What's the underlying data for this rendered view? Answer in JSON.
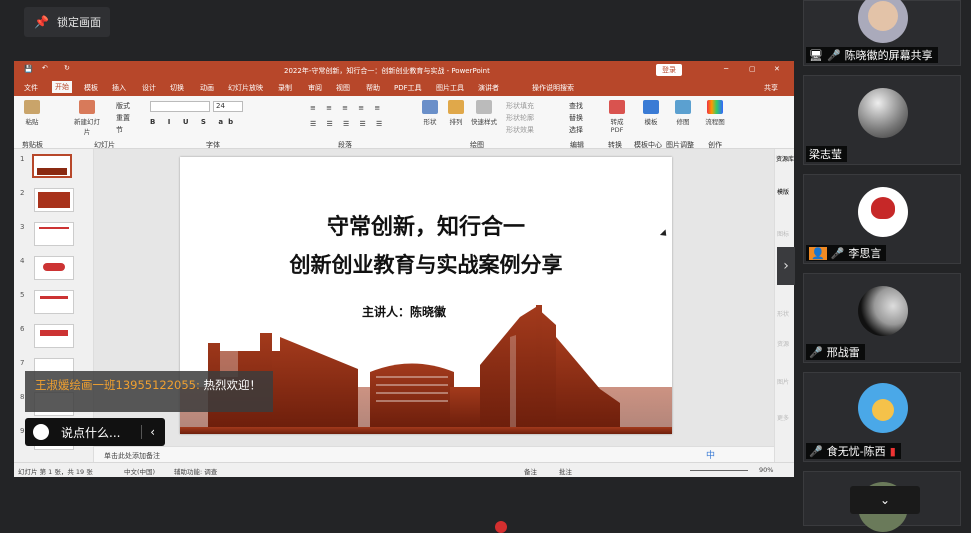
{
  "lock_button": {
    "label": "锁定画面",
    "icon": "pin-icon"
  },
  "ppt": {
    "window_title": "2022年-守常创新，知行合一：创新创业教育与实战 - PowerPoint",
    "login_button": "登录",
    "window_controls": {
      "minimize": "─",
      "restore": "▢",
      "close": "✕"
    },
    "tabs": [
      "文件",
      "开始",
      "模板",
      "插入",
      "设计",
      "切换",
      "动画",
      "幻灯片放映",
      "录制",
      "审阅",
      "视图",
      "帮助",
      "PDF工具",
      "图片工具",
      "演讲者",
      "操作说明搜索"
    ],
    "share_button": "共享",
    "ribbon_groups": [
      "剪贴板",
      "幻灯片",
      "字体",
      "段落",
      "绘图",
      "编辑",
      "转换",
      "模板中心",
      "图片调整",
      "创作"
    ],
    "ribbon_buttons": {
      "paste": "粘贴",
      "new_slide": "新建幻灯片",
      "layout": "版式",
      "reset": "重置",
      "section": "节",
      "shape": "形状",
      "arrange": "排列",
      "quick_style": "快速样式",
      "shape_fill": "形状填充",
      "shape_outline": "形状轮廓",
      "shape_effect": "形状效果",
      "find": "查找",
      "replace": "替换",
      "select": "选择",
      "convert_pdf": "转成PDF",
      "template": "模板",
      "crop": "修图",
      "flowchart": "流程图",
      "font_size": "24"
    },
    "right_panel": {
      "resource_lib": "资源库",
      "items": [
        "模版",
        "图标",
        "素材",
        "形状",
        "资源",
        "图片",
        "更多"
      ]
    },
    "slide": {
      "title_line1": "守常创新，知行合一",
      "title_line2": "创新创业教育与实战案例分享",
      "speaker": "主讲人：陈晓徽"
    },
    "thumbnails": [
      "1",
      "2",
      "3",
      "4",
      "5",
      "6",
      "7",
      "8",
      "9"
    ],
    "notes_placeholder": "单击此处添加备注",
    "status_bar": {
      "slide_info": "幻灯片 第 1 张，共 19 张",
      "language": "中文(中国)",
      "accessibility": "辅助功能: 调查",
      "notes": "备注",
      "comments": "批注",
      "zoom": "90%"
    },
    "ime_label": "中"
  },
  "chat": {
    "sender": "王淑媛绘画一班13955122055",
    "separator": ":",
    "message": "热烈欢迎！",
    "input_placeholder": "说点什么..."
  },
  "participants": [
    {
      "name": "陈晓徽的屏幕共享",
      "icon": "screen-share-icon"
    },
    {
      "name": "梁志莹",
      "icon": ""
    },
    {
      "name": "李思言",
      "icon": "person-icon"
    },
    {
      "name": "邢战雷",
      "icon": "mic-muted-icon"
    },
    {
      "name": "食无忧-陈西",
      "icon": "mic-muted-icon"
    },
    {
      "name": "",
      "icon": "chevron-down-icon"
    }
  ],
  "colors": {
    "ppt_accent": "#b7472a",
    "slide_art": "#8a2a12",
    "chat_name": "#f0a030",
    "bg": "#232426"
  }
}
